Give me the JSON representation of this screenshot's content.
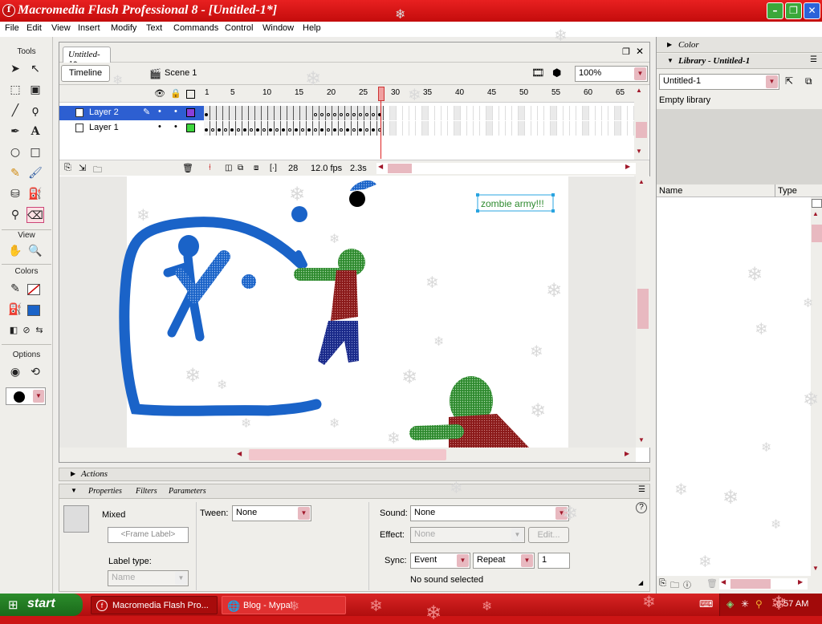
{
  "title_bar": {
    "title": "Macromedia Flash Professional 8 - [Untitled-1*]"
  },
  "menu": [
    "File",
    "Edit",
    "View",
    "Insert",
    "Modify",
    "Text",
    "Commands",
    "Control",
    "Window",
    "Help"
  ],
  "tools": {
    "header": "Tools",
    "view_header": "View",
    "colors_header": "Colors",
    "options_header": "Options"
  },
  "document": {
    "tab": "Untitled-1*",
    "timeline_button": "Timeline",
    "scene": "Scene 1",
    "zoom": "100%",
    "frame_numbers": [
      "1",
      "5",
      "10",
      "15",
      "20",
      "25",
      "30",
      "35",
      "40",
      "45",
      "50",
      "55",
      "60",
      "65"
    ],
    "layers": [
      {
        "name": "Layer 2"
      },
      {
        "name": "Layer 1"
      }
    ],
    "current_frame": "28",
    "fps": "12.0 fps",
    "elapsed": "2.3s",
    "stage_text": "zombie army!!!"
  },
  "panels": {
    "actions": "Actions"
  },
  "properties": {
    "tabs": [
      "Properties",
      "Filters",
      "Parameters"
    ],
    "type_label": "Mixed",
    "frame_label_placeholder": "<Frame Label>",
    "tween_label": "Tween:",
    "tween_value": "None",
    "label_type": "Label type:",
    "label_type_value": "Name",
    "sound_label": "Sound:",
    "sound_value": "None",
    "effect_label": "Effect:",
    "effect_value": "None",
    "edit_button": "Edit...",
    "sync_label": "Sync:",
    "sync_value": "Event",
    "repeat_value": "Repeat",
    "repeat_count": "1",
    "status": "No sound selected",
    "help": "?"
  },
  "library": {
    "color_header": "Color",
    "library_header": "Library - Untitled-1",
    "document_select": "Untitled-1",
    "empty_text": "Empty library",
    "columns": [
      "Name",
      "Type"
    ]
  },
  "taskbar": {
    "start": "start",
    "tasks": [
      "Macromedia Flash Pro...",
      "Blog - Mypal"
    ],
    "time": "6:57 AM"
  },
  "colors": {
    "stage_blue": "#1a63c8",
    "zombie_green": "#2e8a2e",
    "zombie_red": "#8b1a1a",
    "window_red": "#cc1515"
  }
}
